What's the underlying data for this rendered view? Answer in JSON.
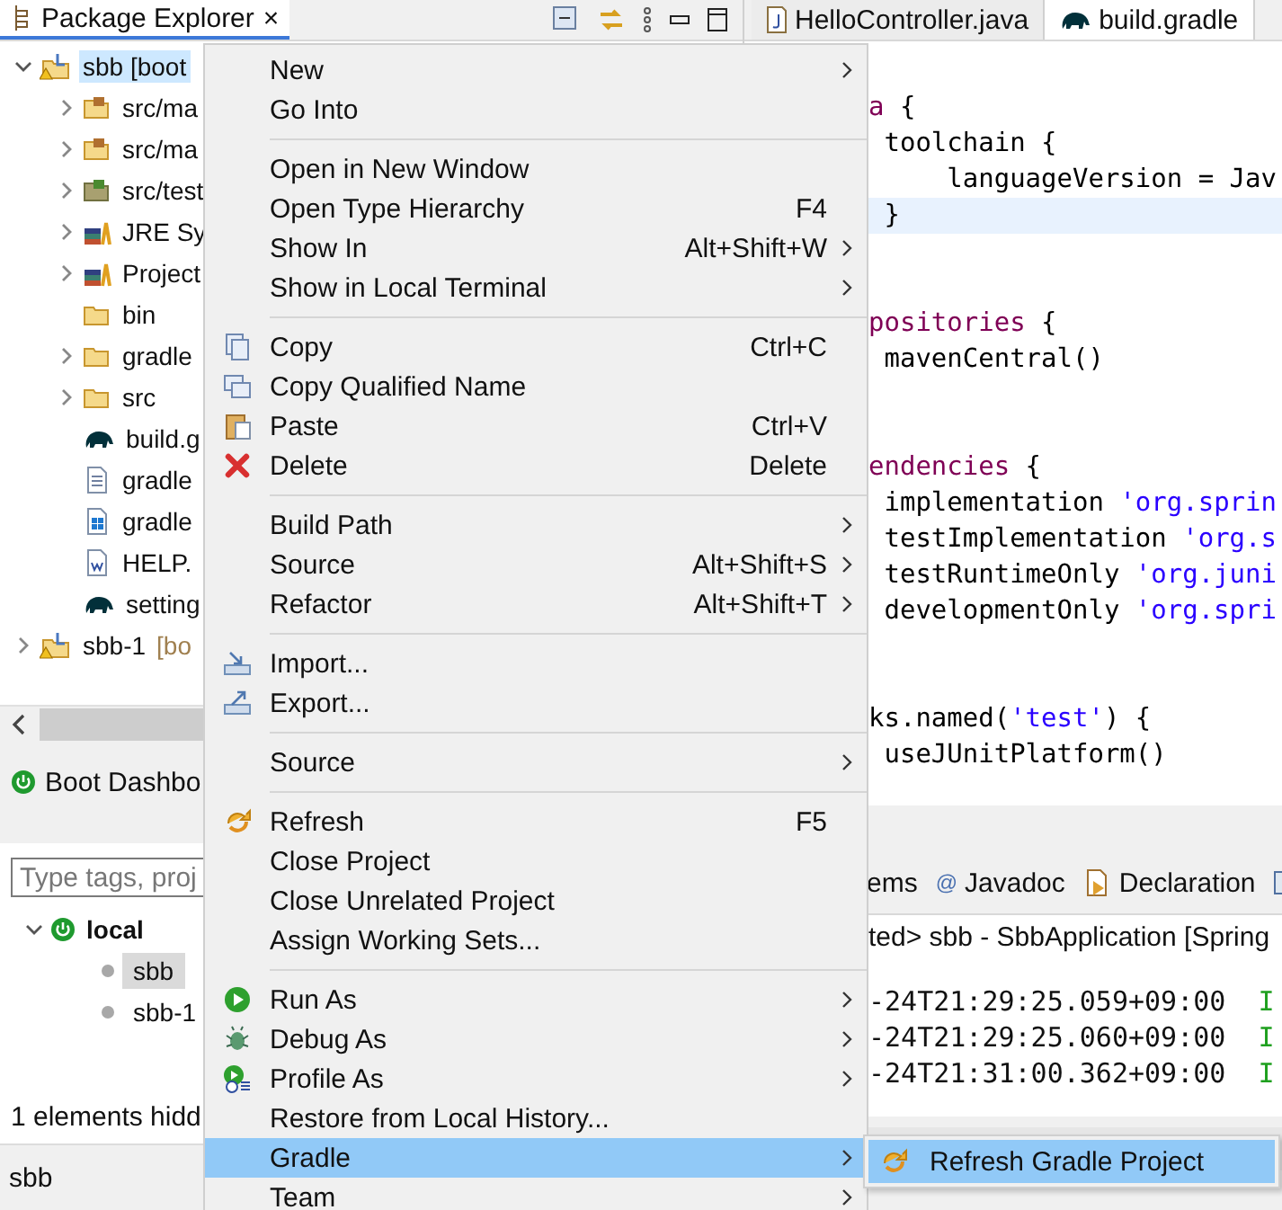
{
  "package_explorer": {
    "tab": {
      "label": "Package Explorer",
      "close": "×"
    },
    "tree": [
      {
        "kind": "project",
        "label": "sbb [boot",
        "expanded": true,
        "selected": true,
        "children": [
          {
            "kind": "source-folder",
            "label": "src/ma",
            "expanded": false
          },
          {
            "kind": "source-folder",
            "label": "src/ma",
            "expanded": false
          },
          {
            "kind": "test-folder",
            "label": "src/test",
            "expanded": false
          },
          {
            "kind": "library",
            "label": "JRE Sy",
            "expanded": false
          },
          {
            "kind": "library",
            "label": "Project",
            "expanded": false
          },
          {
            "kind": "folder",
            "label": "bin"
          },
          {
            "kind": "folder",
            "label": "gradle",
            "expanded": false
          },
          {
            "kind": "folder",
            "label": "src",
            "expanded": false
          },
          {
            "kind": "gradle-file",
            "label": "build.g"
          },
          {
            "kind": "text-file",
            "label": "gradle"
          },
          {
            "kind": "script-file",
            "label": "gradle"
          },
          {
            "kind": "doc-file",
            "label": "HELP."
          },
          {
            "kind": "gradle-file",
            "label": "setting"
          }
        ]
      },
      {
        "kind": "project",
        "label": "sbb-1",
        "suffix": "[bo",
        "expanded": false,
        "selected": false
      }
    ]
  },
  "boot_dashboard": {
    "tab": {
      "label": "Boot Dashbo"
    },
    "filter": {
      "placeholder": "Type tags, proj"
    },
    "tree": [
      {
        "label": "local",
        "expanded": true,
        "children": [
          {
            "label": "sbb",
            "selected": true
          },
          {
            "label": "sbb-1",
            "selected": false
          }
        ]
      }
    ],
    "message": "1 elements hidd"
  },
  "status_bar": {
    "text": "sbb"
  },
  "editor": {
    "tabs": [
      {
        "label": "HelloController.java",
        "kind": "java",
        "selected": false
      },
      {
        "label": "build.gradle",
        "kind": "gradle",
        "selected": true
      }
    ],
    "lines": [
      {
        "current": false,
        "segments": [
          {
            "kind": "keyword",
            "text": "a"
          },
          {
            "kind": "plain",
            "text": " {"
          }
        ]
      },
      {
        "current": false,
        "segments": [
          {
            "kind": "plain",
            "text": " toolchain {"
          }
        ]
      },
      {
        "current": false,
        "segments": [
          {
            "kind": "plain",
            "text": "     languageVersion = Jav"
          }
        ]
      },
      {
        "current": true,
        "segments": [
          {
            "kind": "plain",
            "text": " }"
          }
        ]
      },
      {
        "current": false
      },
      {
        "current": false
      },
      {
        "current": false,
        "segments": [
          {
            "kind": "keyword",
            "text": "positories"
          },
          {
            "kind": "plain",
            "text": " {"
          }
        ]
      },
      {
        "current": false,
        "segments": [
          {
            "kind": "plain",
            "text": " mavenCentral()"
          }
        ]
      },
      {
        "current": false
      },
      {
        "current": false
      },
      {
        "current": false,
        "segments": [
          {
            "kind": "keyword",
            "text": "endencies"
          },
          {
            "kind": "plain",
            "text": " {"
          }
        ]
      },
      {
        "current": false,
        "segments": [
          {
            "kind": "plain",
            "text": " implementation "
          },
          {
            "kind": "string",
            "text": "'org.sprin"
          }
        ]
      },
      {
        "current": false,
        "segments": [
          {
            "kind": "plain",
            "text": " testImplementation "
          },
          {
            "kind": "string",
            "text": "'org.s"
          }
        ]
      },
      {
        "current": false,
        "segments": [
          {
            "kind": "plain",
            "text": " testRuntimeOnly "
          },
          {
            "kind": "string",
            "text": "'org.juni"
          }
        ]
      },
      {
        "current": false,
        "segments": [
          {
            "kind": "plain",
            "text": " developmentOnly "
          },
          {
            "kind": "string",
            "text": "'org.spri"
          }
        ]
      },
      {
        "current": false
      },
      {
        "current": false
      },
      {
        "current": false,
        "segments": [
          {
            "kind": "plain",
            "text": "ks.named("
          },
          {
            "kind": "string",
            "text": "'test'"
          },
          {
            "kind": "plain",
            "text": ") {"
          }
        ]
      },
      {
        "current": false,
        "segments": [
          {
            "kind": "plain",
            "text": " useJUnitPlatform()"
          }
        ]
      }
    ]
  },
  "console": {
    "tabs": [
      {
        "label": "ems",
        "kind": "plain"
      },
      {
        "label": "Javadoc",
        "kind": "javadoc",
        "symbol": "@"
      },
      {
        "label": "Declaration",
        "kind": "declaration"
      },
      {
        "kind": "console"
      }
    ],
    "header": "ted> sbb - SbbApplication [Spring",
    "lines": [
      {
        "time": "-24T21:29:25.059+09:00",
        "level": "I"
      },
      {
        "time": "-24T21:29:25.060+09:00",
        "level": "I"
      },
      {
        "time": "-24T21:31:00.362+09:00",
        "level": "I"
      }
    ]
  },
  "context_menu": {
    "items": [
      {
        "kind": "item",
        "label": "New",
        "submenu": true,
        "highlighted": false
      },
      {
        "kind": "item",
        "label": "Go Into",
        "highlighted": false
      },
      {
        "kind": "separator"
      },
      {
        "kind": "item",
        "label": "Open in New Window",
        "highlighted": false
      },
      {
        "kind": "item",
        "label": "Open Type Hierarchy",
        "shortcut": "F4",
        "highlighted": false
      },
      {
        "kind": "item",
        "label": "Show In",
        "shortcut": "Alt+Shift+W",
        "submenu": true,
        "highlighted": false
      },
      {
        "kind": "item",
        "label": "Show in Local Terminal",
        "submenu": true,
        "highlighted": false
      },
      {
        "kind": "separator"
      },
      {
        "kind": "item",
        "label": "Copy",
        "shortcut": "Ctrl+C",
        "highlighted": false
      },
      {
        "kind": "item",
        "label": "Copy Qualified Name",
        "highlighted": false
      },
      {
        "kind": "item",
        "label": "Paste",
        "shortcut": "Ctrl+V",
        "highlighted": false
      },
      {
        "kind": "item",
        "label": "Delete",
        "shortcut": "Delete",
        "highlighted": false
      },
      {
        "kind": "separator"
      },
      {
        "kind": "item",
        "label": "Build Path",
        "submenu": true,
        "highlighted": false
      },
      {
        "kind": "item",
        "label": "Source",
        "shortcut": "Alt+Shift+S",
        "submenu": true,
        "highlighted": false
      },
      {
        "kind": "item",
        "label": "Refactor",
        "shortcut": "Alt+Shift+T",
        "submenu": true,
        "highlighted": false
      },
      {
        "kind": "separator"
      },
      {
        "kind": "item",
        "label": "Import...",
        "highlighted": false
      },
      {
        "kind": "item",
        "label": "Export...",
        "highlighted": false
      },
      {
        "kind": "separator"
      },
      {
        "kind": "item",
        "label": "Source",
        "submenu": true,
        "highlighted": false
      },
      {
        "kind": "separator"
      },
      {
        "kind": "item",
        "label": "Refresh",
        "shortcut": "F5",
        "highlighted": false
      },
      {
        "kind": "item",
        "label": "Close Project",
        "highlighted": false
      },
      {
        "kind": "item",
        "label": "Close Unrelated Project",
        "highlighted": false
      },
      {
        "kind": "item",
        "label": "Assign Working Sets...",
        "highlighted": false
      },
      {
        "kind": "separator"
      },
      {
        "kind": "item",
        "label": "Run As",
        "submenu": true,
        "highlighted": false
      },
      {
        "kind": "item",
        "label": "Debug As",
        "submenu": true,
        "highlighted": false
      },
      {
        "kind": "item",
        "label": "Profile As",
        "submenu": true,
        "highlighted": false
      },
      {
        "kind": "item",
        "label": "Restore from Local History...",
        "highlighted": false
      },
      {
        "kind": "item",
        "label": "Gradle",
        "submenu": true,
        "highlighted": true
      },
      {
        "kind": "item",
        "label": "Team",
        "submenu": true,
        "highlighted": false
      }
    ]
  },
  "submenu": {
    "items": [
      {
        "label": "Refresh Gradle Project",
        "highlighted": true
      }
    ]
  }
}
